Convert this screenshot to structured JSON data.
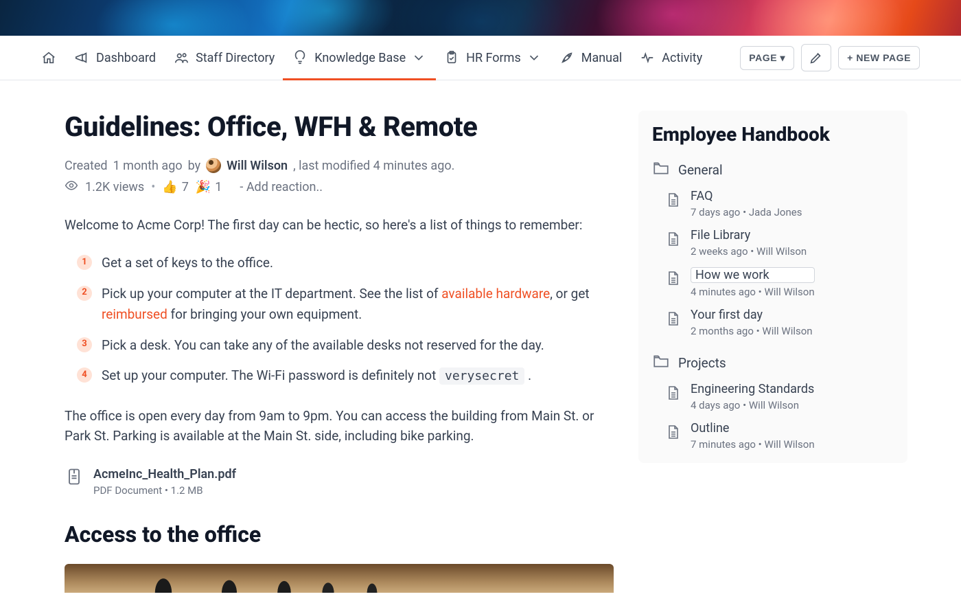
{
  "nav": {
    "items": [
      {
        "label": "Dashboard"
      },
      {
        "label": "Staff Directory"
      },
      {
        "label": "Knowledge Base",
        "dropdown": true,
        "active": true
      },
      {
        "label": "HR Forms",
        "dropdown": true
      },
      {
        "label": "Manual"
      },
      {
        "label": "Activity"
      }
    ]
  },
  "actions": {
    "page_button": "PAGE ▾",
    "new_page": "+ NEW PAGE"
  },
  "page": {
    "title": "Guidelines: Office, WFH & Remote",
    "created_prefix": "Created ",
    "created_time": "1 month ago",
    "created_by": " by ",
    "author": "Will Wilson",
    "modified_suffix": ", last modified 4 minutes ago.",
    "views": "1.2K views",
    "reaction_thumb_count": "7",
    "reaction_party_count": "1",
    "add_reaction": "- Add reaction..",
    "intro": "Welcome to Acme Corp! The first day can be hectic, so here's a list of things to remember:",
    "steps": {
      "s1": "Get a set of keys to the office.",
      "s2a": "Pick up your computer at the IT department. See the list of ",
      "s2_link1": "available hardware",
      "s2b": ", or get ",
      "s2_link2": "reimbursed",
      "s2c": " for bringing your own equipment.",
      "s3": "Pick a desk. You can take any of the available desks not reserved for the day.",
      "s4a": "Set up your computer. The Wi-Fi password is definitely not ",
      "s4_code": "verysecret",
      "s4b": "."
    },
    "hours": "The office is open every day from 9am to 9pm. You can access the building from Main St. or Park St. Parking is available at the Main St. side, including bike parking.",
    "attachment": {
      "name": "AcmeInc_Health_Plan.pdf",
      "meta": "PDF Document • 1.2 MB"
    },
    "h2": "Access to the office"
  },
  "sidebar": {
    "title": "Employee Handbook",
    "sections": [
      {
        "title": "General",
        "docs": [
          {
            "title": "FAQ",
            "meta": "7 days ago • Jada Jones"
          },
          {
            "title": "File Library",
            "meta": "2 weeks ago • Will Wilson"
          },
          {
            "title": "How we work",
            "meta": "4 minutes ago • Will Wilson",
            "selected": true
          },
          {
            "title": "Your first day",
            "meta": "2 months ago • Will Wilson"
          }
        ]
      },
      {
        "title": "Projects",
        "docs": [
          {
            "title": "Engineering Standards",
            "meta": "4 days ago • Will Wilson"
          },
          {
            "title": "Outline",
            "meta": "7 minutes ago • Will Wilson"
          }
        ]
      }
    ]
  }
}
